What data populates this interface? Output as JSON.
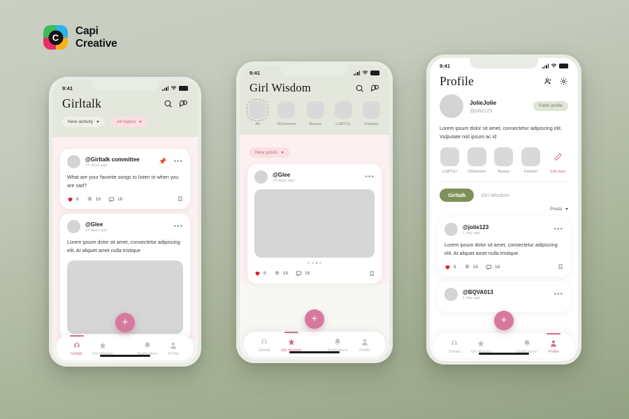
{
  "brand": {
    "mark_letter": "C",
    "line1": "Capi",
    "line2": "Creative"
  },
  "colors": {
    "background_top": "#c9cfc2",
    "background_bottom": "#93a283",
    "accent_pink": "#d7799f",
    "accent_green": "#7e9159",
    "chip_pink_bg": "#fbdfe2",
    "chip_pink_text": "#c4687c",
    "heart_red": "#e0202a"
  },
  "phone1": {
    "status": {
      "time": "9:41"
    },
    "header": {
      "title": "Girltalk",
      "icons": [
        "search-icon",
        "chat-icon"
      ]
    },
    "filters": [
      {
        "label": "New activity",
        "style": "neutral"
      },
      {
        "label": "All topics",
        "style": "pink"
      }
    ],
    "posts": [
      {
        "user": "@Girltalk committee",
        "time": "21 days ago",
        "pinned": true,
        "text": "What are your favorite songs to listen to when you are sad?",
        "has_image": false,
        "stats": {
          "likes": "8",
          "ideas": "16",
          "comments": "16"
        }
      },
      {
        "user": "@Glee",
        "time": "24 days ago",
        "pinned": false,
        "text": "Lorem ipsum dolor sit amet, consectetur adipiscing elit. At aliquet amet nulla tristique",
        "has_image": true,
        "stats": {
          "likes": "8",
          "ideas": "16",
          "comments": "16"
        }
      }
    ],
    "fab_label": "+",
    "nav": [
      {
        "label": "Girltalk",
        "icon": "girltalk-icon",
        "active": true
      },
      {
        "label": "Girl Wisdom",
        "icon": "star-icon",
        "active": false
      },
      {
        "label": "Notifications",
        "icon": "bell-icon",
        "active": false
      },
      {
        "label": "Profile",
        "icon": "person-icon",
        "active": false
      }
    ]
  },
  "phone2": {
    "status": {
      "time": "9:41"
    },
    "header": {
      "title": "Girl Wisdom",
      "icons": [
        "search-icon",
        "chat-icon"
      ]
    },
    "categories": [
      {
        "label": "All",
        "selected": true
      },
      {
        "label": "#52women",
        "selected": false
      },
      {
        "label": "Beauty",
        "selected": false
      },
      {
        "label": "LGBTQ+",
        "selected": false
      },
      {
        "label": "Fashion",
        "selected": false
      }
    ],
    "filters": [
      {
        "label": "New posts",
        "style": "pink"
      }
    ],
    "post": {
      "user": "@Glee",
      "time": "24 days ago",
      "carousel_dots": 4,
      "carousel_active": 3,
      "stats": {
        "likes": "8",
        "ideas": "16",
        "comments": "16"
      }
    },
    "fab_label": "+",
    "nav": [
      {
        "label": "Girltalk",
        "icon": "girltalk-icon",
        "active": false
      },
      {
        "label": "Girl Wisdom",
        "icon": "star-icon",
        "active": true
      },
      {
        "label": "Notifications",
        "icon": "bell-icon",
        "active": false
      },
      {
        "label": "Profile",
        "icon": "person-icon",
        "active": false
      }
    ]
  },
  "phone3": {
    "status": {
      "time": "9:41"
    },
    "header": {
      "title": "Profile",
      "icons": [
        "friends-icon",
        "gear-icon"
      ]
    },
    "profile": {
      "name": "JolieJolie",
      "handle": "@jolie123",
      "badge": "Public profile",
      "bio": "Lorem ipsum dolor sit amet, consectetur adipiscing elit. Vulputate nisl ipsum ac id"
    },
    "topics": [
      {
        "label": "LGBTQ+",
        "kind": "topic"
      },
      {
        "label": "#25women",
        "kind": "topic"
      },
      {
        "label": "Beauty",
        "kind": "topic"
      },
      {
        "label": "Fashion",
        "kind": "topic"
      },
      {
        "label": "Edit topic",
        "kind": "edit"
      }
    ],
    "tabs": [
      {
        "label": "Girltalk",
        "active": true
      },
      {
        "label": "Girl Wisdom",
        "active": false
      }
    ],
    "sort": {
      "label": "Posts"
    },
    "posts": [
      {
        "user": "@jolie123",
        "time": "1 day ago",
        "text": "Lorem ipsum dolor sit amet, consectetur adipiscing elit. At aliquet amet nulla tristique",
        "stats": {
          "likes": "8",
          "ideas": "16",
          "comments": "16"
        }
      },
      {
        "user": "@BQVA013",
        "time": "1 day ago",
        "text": "",
        "stats": {
          "likes": "",
          "ideas": "",
          "comments": ""
        }
      }
    ],
    "fab_label": "+",
    "nav": [
      {
        "label": "Girltalk",
        "icon": "girltalk-icon",
        "active": false
      },
      {
        "label": "Girl Wisdom",
        "icon": "star-icon",
        "active": false
      },
      {
        "label": "Notifications",
        "icon": "bell-icon",
        "active": false
      },
      {
        "label": "Profile",
        "icon": "person-icon",
        "active": true
      }
    ]
  }
}
